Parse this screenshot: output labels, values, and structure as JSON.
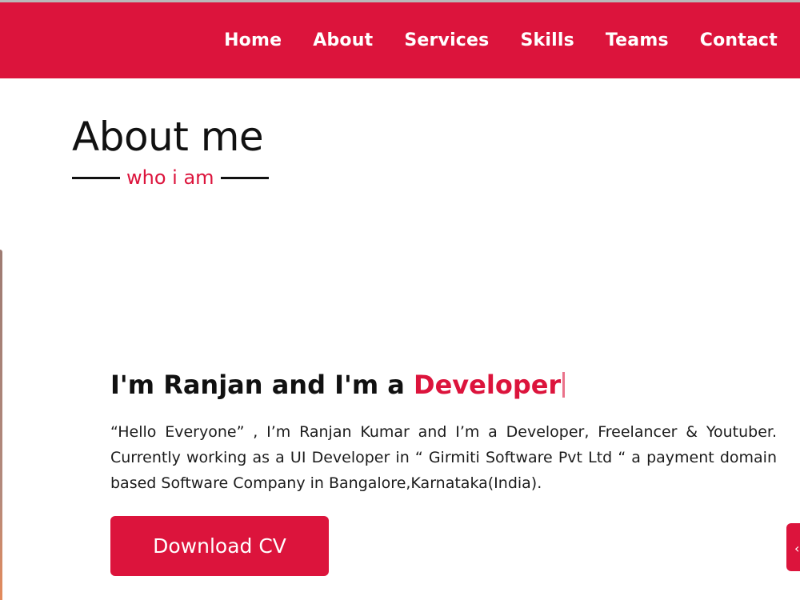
{
  "nav": {
    "items": [
      {
        "label": "Home"
      },
      {
        "label": "About"
      },
      {
        "label": "Services"
      },
      {
        "label": "Skills"
      },
      {
        "label": "Teams"
      },
      {
        "label": "Contact"
      }
    ]
  },
  "about": {
    "title": "About me",
    "subtitle": "who i am",
    "heading_prefix": "I'm Ranjan and I'm a ",
    "heading_role": "Developer",
    "description": "“Hello Everyone” , I’m Ranjan Kumar and I’m a Developer, Freelancer & Youtuber. Currently working as a UI Developer in “ Girmiti Software Pvt Ltd “ a payment domain based Software Company in Bangalore,Karnataka(India).",
    "cv_button": "Download CV"
  },
  "colors": {
    "accent": "#dc143c",
    "text": "#111111",
    "background": "#ffffff"
  },
  "icons": {
    "scroll_button": "chevron-up-icon"
  }
}
